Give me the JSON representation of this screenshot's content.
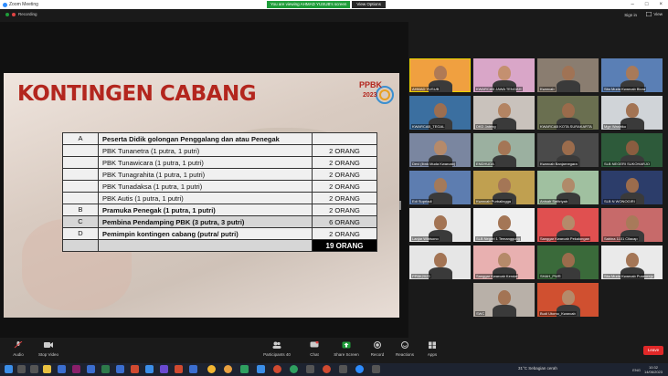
{
  "window": {
    "title": "Zoom Meeting",
    "controls": [
      "–",
      "□",
      "×"
    ]
  },
  "share_banner": {
    "text": "You are viewing AHMAD YUSUB's screen",
    "view_options": "View Options"
  },
  "topbar": {
    "recording": "Recording",
    "sign_in": "Sign in",
    "view": "View"
  },
  "slide": {
    "title": "KONTINGEN CABANG",
    "logo_text": "PPBK",
    "logo_year": "2023",
    "rows": [
      {
        "letter": "A",
        "label": "Peserta Didik golongan Penggalang dan atau Penegak",
        "value": "",
        "bold": true,
        "style": "light"
      },
      {
        "letter": "",
        "label": "PBK Tunanetra (1 putra, 1 putri)",
        "value": "2 ORANG",
        "bold": false,
        "style": "light"
      },
      {
        "letter": "",
        "label": "PBK Tunawicara (1 putra, 1 putri)",
        "value": "2 ORANG",
        "bold": false,
        "style": "light"
      },
      {
        "letter": "",
        "label": "PBK Tunagrahita (1 putra, 1 putri)",
        "value": "2 ORANG",
        "bold": false,
        "style": "light"
      },
      {
        "letter": "",
        "label": "PBK Tunadaksa (1 putra, 1 putri)",
        "value": "2 ORANG",
        "bold": false,
        "style": "light"
      },
      {
        "letter": "",
        "label": "PBK Autis (1 putra, 1 putri)",
        "value": "2 ORANG",
        "bold": false,
        "style": "light"
      },
      {
        "letter": "B",
        "label": "Pramuka Penegak   (1 putra, 1 putri)",
        "value": "2 ORANG",
        "bold": true,
        "style": "light"
      },
      {
        "letter": "C",
        "label": "Pembina Pendamping PBK (3 putra, 3 putri)",
        "value": "6 ORANG",
        "bold": true,
        "style": "grey"
      },
      {
        "letter": "D",
        "label": "Pemimpin kontingen cabang (putra/ putri)",
        "value": "2 ORANG",
        "bold": true,
        "style": "light"
      }
    ],
    "total": "19 ORANG"
  },
  "participants": [
    {
      "name": "AHMAD YUSUB",
      "bg": "#f0a040",
      "skin": "#b07a55",
      "active": true
    },
    {
      "name": "KWARCAB JAWA TENGAH",
      "bg": "#d9a6c8",
      "skin": "#c49070",
      "active": false
    },
    {
      "name": "Kwarcab",
      "bg": "#8a7d70",
      "skin": "#a07355",
      "active": false
    },
    {
      "name": "Sita Muda Kwarcab Blora",
      "bg": "#5a7fb5",
      "skin": "#a87a5a",
      "active": false
    },
    {
      "name": "KWARCAB_TEGAL",
      "bg": "#3b6fa0",
      "skin": "#9c6e50",
      "active": false
    },
    {
      "name": "DKD Jateng",
      "bg": "#c9c2bc",
      "skin": "#b38463",
      "active": false
    },
    {
      "name": "KWARCAB KOTA SURAKARTA",
      "bg": "#6a6f50",
      "skin": "#9a6b4b",
      "active": false
    },
    {
      "name": "Mgn Wasiriko",
      "bg": "#d0d4d8",
      "skin": "#a37454",
      "active": false
    },
    {
      "name": "Devi (Ibnk Muda Kwarcab)",
      "bg": "#7a86a0",
      "skin": "#b58a6a",
      "active": false
    },
    {
      "name": "ENDHUDA",
      "bg": "#9bb0a0",
      "skin": "#a47656",
      "active": false
    },
    {
      "name": "Kwarcab Banjarnegara",
      "bg": "#4a4a4a",
      "skin": "#9b6c4c",
      "active": false
    },
    {
      "name": "SLB NEGERI SUKOHARJO",
      "bg": "#2d5a3a",
      "skin": "#8a5d40",
      "active": false
    },
    {
      "name": "Edi Supriadi",
      "bg": "#5d7db0",
      "skin": "#a47a5a",
      "active": false
    },
    {
      "name": "Kwarcab Purbalingga",
      "bg": "#c0a050",
      "skin": "#a47656",
      "active": false
    },
    {
      "name": "Anisah Safitriyah",
      "bg": "#a0c0a0",
      "skin": "#b08a6a",
      "active": false
    },
    {
      "name": "SLB N WONOGIRI",
      "bg": "#2c3d6a",
      "skin": "#9b6c4c",
      "active": false
    },
    {
      "name": "Lanjar Wibisono",
      "bg": "#e8e8e8",
      "skin": "#a37454",
      "active": false
    },
    {
      "name": "SLB Negeri 1 Temanggung",
      "bg": "#f0f0f0",
      "skin": "#a47656",
      "active": false
    },
    {
      "name": "Sanggar Kwarcab Pekalongan",
      "bg": "#e05050",
      "skin": "#b58a6a",
      "active": false
    },
    {
      "name": "Sabina 1101 Cilacap",
      "bg": "#c76a6a",
      "skin": "#a87a5a",
      "active": false
    },
    {
      "name": "PPBK2023",
      "bg": "#e6e6e6",
      "skin": "#a37454",
      "active": false
    },
    {
      "name": "Sanggar Kwarcab Kendal",
      "bg": "#e8b0b0",
      "skin": "#b58a6a",
      "active": false
    },
    {
      "name": "SHAH_PWR",
      "bg": "#3a6a3a",
      "skin": "#9b6c4c",
      "active": false
    },
    {
      "name": "Sita Muda Kwarcab Purworejo",
      "bg": "#eaeaea",
      "skin": "#a47656",
      "active": false
    },
    {
      "name": "",
      "bg": "#1a1a1a",
      "skin": "#1a1a1a",
      "active": false
    },
    {
      "name": "SWC",
      "bg": "#b8b0a8",
      "skin": "#a37454",
      "active": false
    },
    {
      "name": "Budi Utomo_Kwarcab",
      "bg": "#d05030",
      "skin": "#b58a6a",
      "active": false
    }
  ],
  "toolbar": {
    "audio": "Audio",
    "stop_video": "Stop Video",
    "participants": "Participants",
    "participants_count": "40",
    "chat": "Chat",
    "share_screen": "Share Screen",
    "record": "Record",
    "reactions": "Reactions",
    "apps": "Apps",
    "leave": "Leave"
  },
  "taskbar": {
    "weather": "31°C  Sebagian cerah",
    "lang": "ENG",
    "time": "10:32",
    "date": "14/06/2023"
  },
  "colors": {
    "accent": "#1f9d3a",
    "leave": "#e02828",
    "title_red": "#b3261e",
    "active_speaker": "#e9d300"
  }
}
